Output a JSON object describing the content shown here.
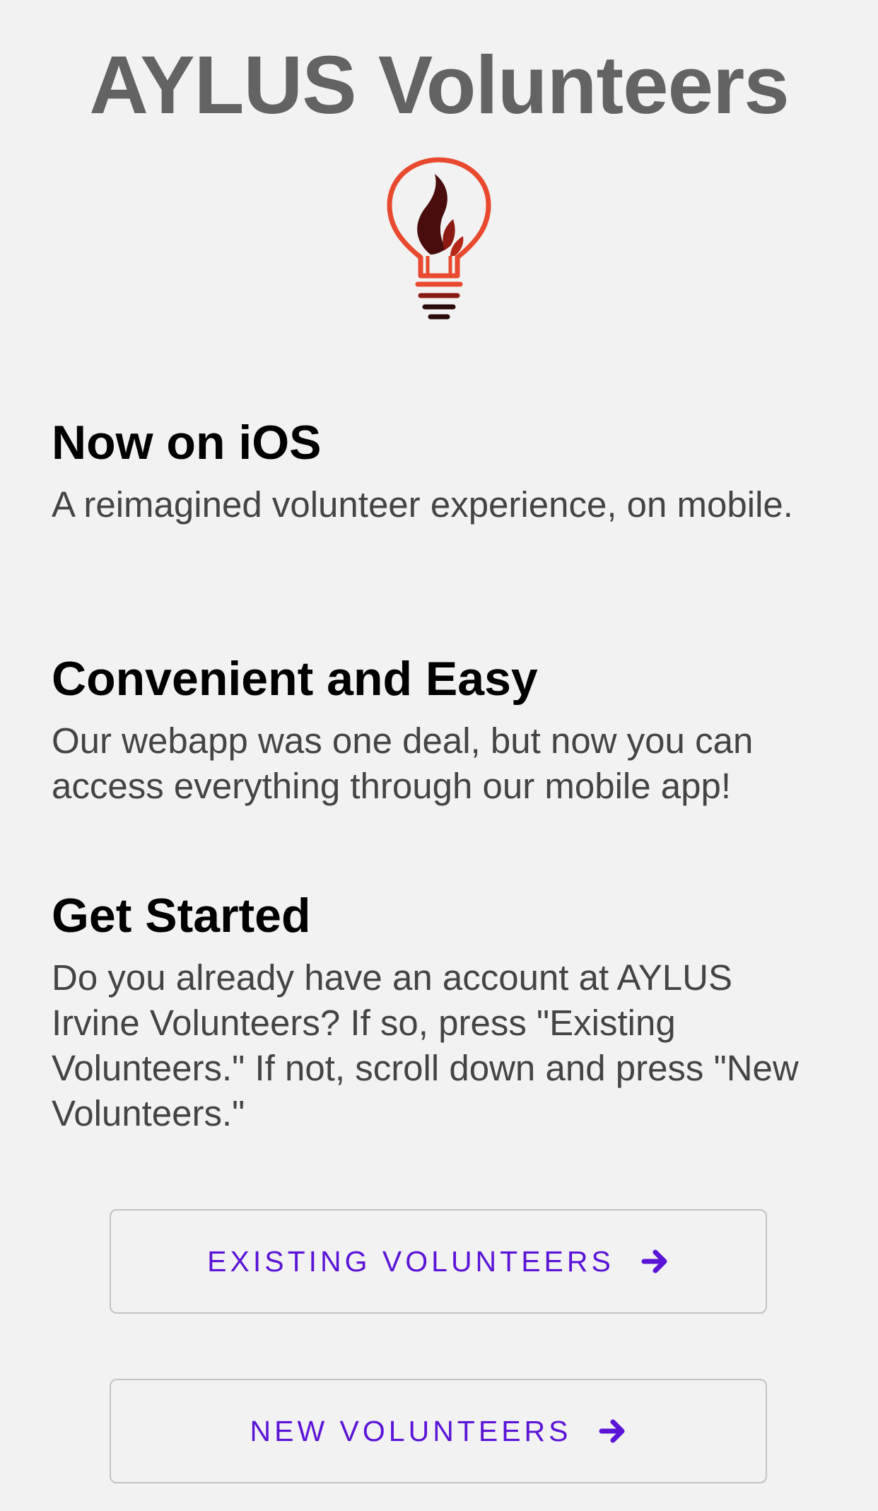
{
  "header": {
    "title": "AYLUS Volunteers",
    "logo_icon": "lightbulb-flame-logo"
  },
  "sections": [
    {
      "heading": "Now on iOS",
      "body": "A reimagined volunteer experience, on mobile."
    },
    {
      "heading": "Convenient and Easy",
      "body": "Our webapp was one deal, but now you can access everything through our mobile app!"
    },
    {
      "heading": "Get Started",
      "body": "Do you already have an account at AYLUS Irvine Volunteers? If so, press \"Existing Volunteers.\" If not, scroll down and press \"New Volunteers.\""
    }
  ],
  "buttons": {
    "existing_label": "EXISTING VOLUNTEERS",
    "new_label": "NEW VOLUNTEERS",
    "arrow_icon": "arrow-right-icon"
  },
  "colors": {
    "background": "#f2f2f2",
    "title": "#636363",
    "accent": "#5b14d6",
    "logo_red": "#e8492f",
    "logo_flame": "#4a0d0d"
  }
}
